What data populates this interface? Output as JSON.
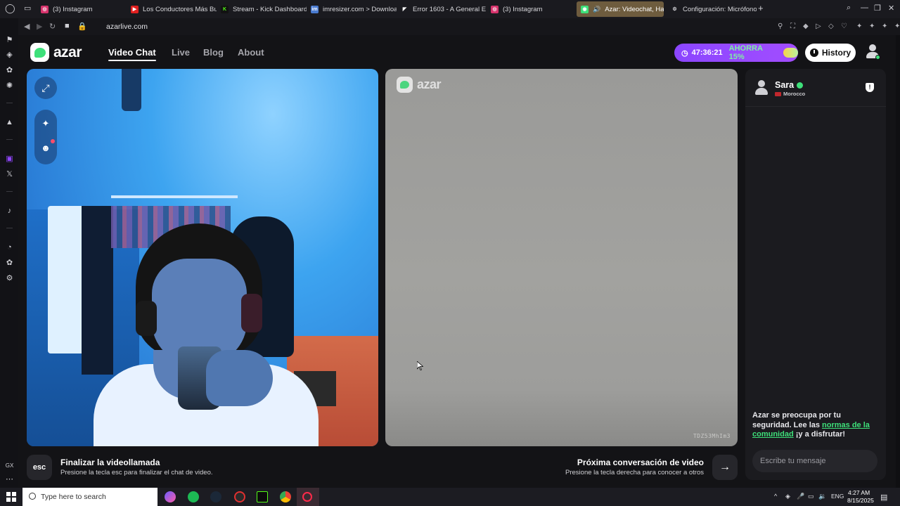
{
  "browser": {
    "tabs": [
      {
        "label": "(3) Instagram",
        "color": "#d6336c",
        "glyph": "◎"
      },
      {
        "label": "Los Conductores Más Bu",
        "color": "#e02020",
        "glyph": "▶"
      },
      {
        "label": "Stream - Kick Dashboard",
        "color": "#53fc18",
        "glyph": "K"
      },
      {
        "label": "imresizer.com > Downloa",
        "color": "#4a7bd0",
        "glyph": "im"
      },
      {
        "label": "Error 1603 - A General E",
        "color": "#ffffff",
        "glyph": "◤"
      },
      {
        "label": "(3) Instagram",
        "color": "#d6336c",
        "glyph": "◎"
      },
      {
        "label": "Azar: Videochat, Haz",
        "color": "#3ee07a",
        "glyph": "◉"
      },
      {
        "label": "Configuración: Micrófono",
        "color": "#9a9aa0",
        "glyph": "⚙"
      }
    ],
    "url": "azarlive.com"
  },
  "site": {
    "logo_text": "azar",
    "nav": {
      "video_chat": "Video Chat",
      "live": "Live",
      "blog": "Blog",
      "about": "About"
    },
    "promo": {
      "timer": "47:36:21",
      "save": "AHORRA 15%"
    },
    "history_label": "History"
  },
  "remote": {
    "logo_text": "azar",
    "stream_id": "TDZ53MhIm3"
  },
  "chat": {
    "peer_name": "Sara",
    "peer_country": "Morocco",
    "safety_prefix": "Azar se preocupa por tu seguridad. Lee las ",
    "safety_link": "normas de la comunidad",
    "safety_suffix": " ¡y a disfrutar!",
    "input_placeholder": "Escribe tu mensaje"
  },
  "controls": {
    "esc_key": "esc",
    "end_title": "Finalizar la videollamada",
    "end_desc": "Presione la tecla esc para finalizar el chat de video.",
    "next_title": "Próxima conversación de video",
    "next_desc": "Presione la tecla derecha para conocer a otros"
  },
  "taskbar": {
    "search_placeholder": "Type here to search",
    "language": "ENG",
    "time": "4:27 AM",
    "date": "8/15/2025"
  },
  "colors": {
    "brand_green": "#3ee07a",
    "promo_purple": "#9a4aff"
  }
}
